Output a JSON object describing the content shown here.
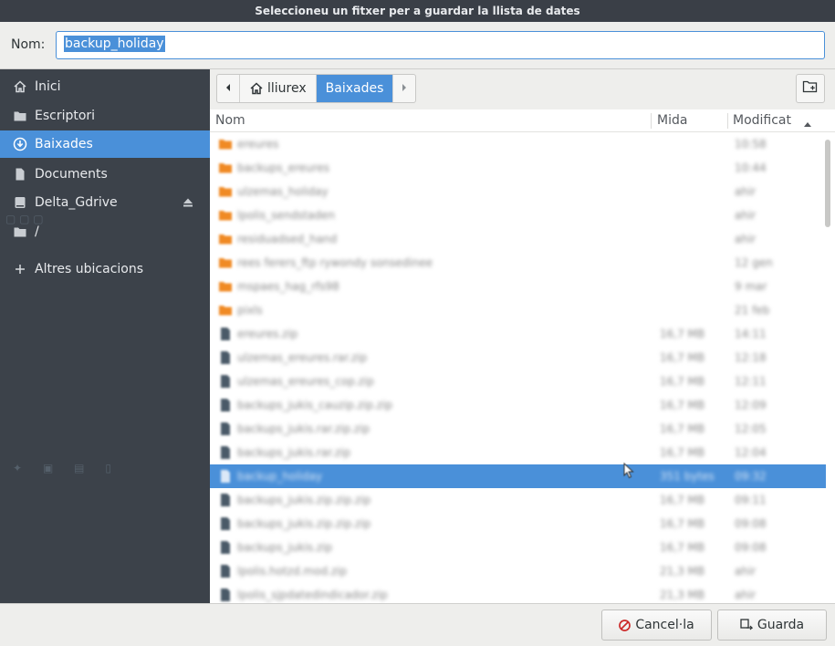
{
  "window": {
    "title": "Seleccioneu un fitxer per a guardar la llista de dates"
  },
  "name_field": {
    "label": "Nom:",
    "value": "backup_holiday"
  },
  "sidebar": {
    "items": [
      {
        "label": "Inici",
        "icon": "home-icon"
      },
      {
        "label": "Escriptori",
        "icon": "folder-icon"
      },
      {
        "label": "Baixades",
        "icon": "download-icon",
        "active": true
      },
      {
        "label": "Documents",
        "icon": "document-icon"
      },
      {
        "label": "Delta_Gdrive",
        "icon": "drive-icon",
        "eject": true
      },
      {
        "label": "/",
        "icon": "folder-icon"
      },
      {
        "label": "Altres ubicacions",
        "icon": "plus-icon"
      }
    ]
  },
  "pathbar": {
    "home_label": "lliurex",
    "current_label": "Baixades"
  },
  "columns": {
    "name": "Nom",
    "size": "Mida",
    "modified": "Modificat"
  },
  "files": [
    {
      "name": "ereures",
      "size": "",
      "modified": "10:58",
      "type": "folder"
    },
    {
      "name": "backups_ereures",
      "size": "",
      "modified": "10:44",
      "type": "folder"
    },
    {
      "name": "ulzemas_holiday",
      "size": "",
      "modified": "ahir",
      "type": "folder"
    },
    {
      "name": "lpolis_sendstaden",
      "size": "",
      "modified": "ahir",
      "type": "folder"
    },
    {
      "name": "residuadsed_hand",
      "size": "",
      "modified": "ahir",
      "type": "folder"
    },
    {
      "name": "rees ferers_ftp rywondy sonsedinee",
      "size": "",
      "modified": "12 gen",
      "type": "folder"
    },
    {
      "name": "mspaes_hag_rfs98",
      "size": "",
      "modified": "9 mar",
      "type": "folder"
    },
    {
      "name": "pixls",
      "size": "",
      "modified": "21 feb",
      "type": "folder"
    },
    {
      "name": "ereures.zip",
      "size": "16,7 MB",
      "modified": "14:11",
      "type": "file"
    },
    {
      "name": "ulzemas_ereures.rar.zip",
      "size": "16,7 MB",
      "modified": "12:18",
      "type": "file"
    },
    {
      "name": "ulzemas_ereures_cop.zip",
      "size": "16,7 MB",
      "modified": "12:11",
      "type": "file"
    },
    {
      "name": "backups_jukis_cauzip.zip.zip",
      "size": "16,7 MB",
      "modified": "12:09",
      "type": "file"
    },
    {
      "name": "backups_jukis.rar.zip.zip",
      "size": "16,7 MB",
      "modified": "12:05",
      "type": "file"
    },
    {
      "name": "backups_jukis.rar.zip",
      "size": "16,7 MB",
      "modified": "12:04",
      "type": "file"
    },
    {
      "name": "backup_holiday",
      "size": "351 bytes",
      "modified": "09:32",
      "type": "file",
      "selected": true
    },
    {
      "name": "backups_jukis.zip.zip.zip",
      "size": "16,7 MB",
      "modified": "09:11",
      "type": "file"
    },
    {
      "name": "backups_jukis.zip.zip.zip",
      "size": "16,7 MB",
      "modified": "09:08",
      "type": "file"
    },
    {
      "name": "backups_jukis.zip",
      "size": "16,7 MB",
      "modified": "09:08",
      "type": "file"
    },
    {
      "name": "lpolis.hotzd.mod.zip",
      "size": "21,3 MB",
      "modified": "ahir",
      "type": "file"
    },
    {
      "name": "lpolis_sjpdatedindicador.zip",
      "size": "21,3 MB",
      "modified": "ahir",
      "type": "file"
    }
  ],
  "buttons": {
    "cancel": "Cancel·la",
    "save": "Guarda"
  },
  "colors": {
    "accent": "#4a90d9",
    "sidebar_bg": "#3c424a",
    "folder": "#f08a24",
    "file": "#4a5a68"
  }
}
